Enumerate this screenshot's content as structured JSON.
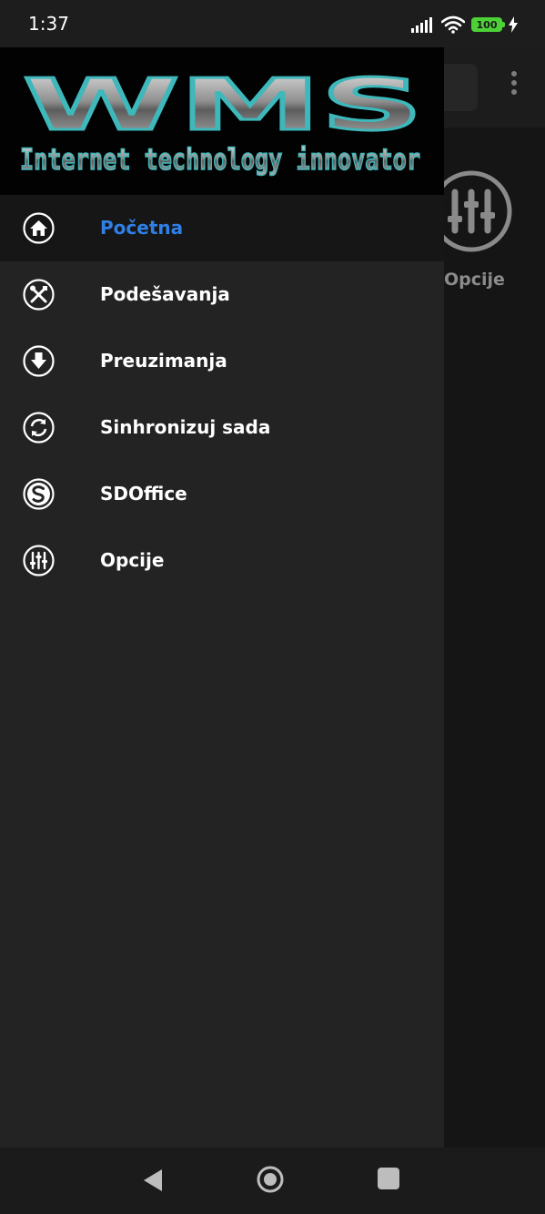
{
  "status_bar": {
    "time": "1:37",
    "battery_level": "100",
    "icons": [
      "signal-icon",
      "wifi-icon",
      "battery-icon",
      "charging-icon"
    ]
  },
  "background_screen": {
    "tile_label": "Opcije",
    "tile_icon": "sliders-icon"
  },
  "drawer": {
    "logo": {
      "title": "WMS",
      "tagline": "Internet technology innovator"
    },
    "items": [
      {
        "label": "Početna",
        "icon": "home-icon",
        "active": true
      },
      {
        "label": "Podešavanja",
        "icon": "tools-icon",
        "active": false
      },
      {
        "label": "Preuzimanja",
        "icon": "download-icon",
        "active": false
      },
      {
        "label": "Sinhronizuj sada",
        "icon": "sync-icon",
        "active": false
      },
      {
        "label": "SDOffice",
        "icon": "sdoffice-icon",
        "active": false
      },
      {
        "label": "Opcije",
        "icon": "sliders-icon",
        "active": false
      }
    ]
  },
  "colors": {
    "accent": "#2f7fe6",
    "drawer_bg": "#232323",
    "active_row_bg": "#161616",
    "logo_teal": "#3fb8bb"
  },
  "nav_bar": {
    "buttons": [
      "back-icon",
      "home-circle-icon",
      "recents-icon"
    ]
  }
}
